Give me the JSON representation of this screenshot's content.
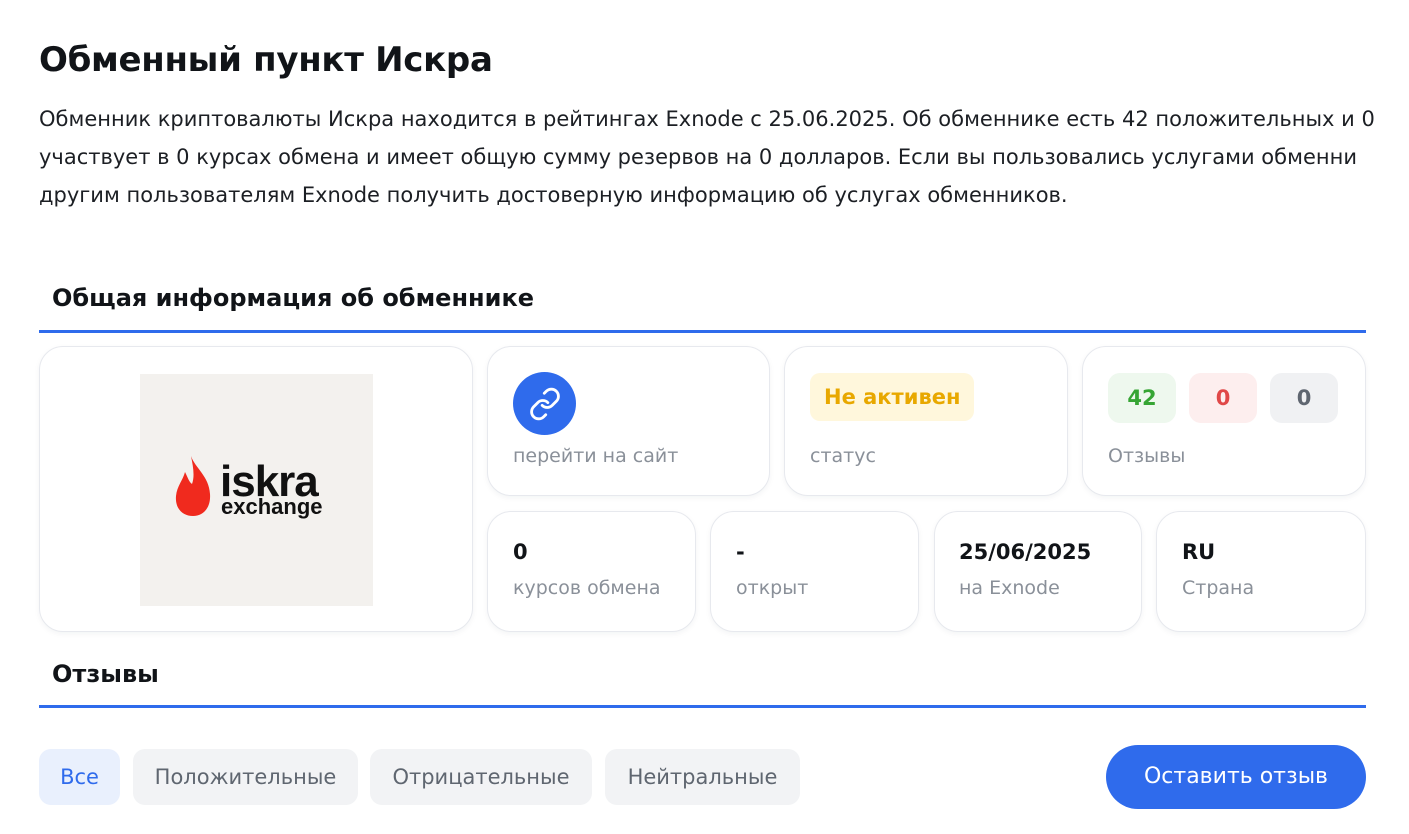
{
  "page": {
    "title": "Обменный пункт Искра",
    "intro_lines": [
      "Обменник криптовалюты Искра находится в рейтингах Exnode с 25.06.2025. Об обменнике есть 42 положительных и 0",
      "участвует в 0 курсах обмена и имеет общую сумму резервов на 0 долларов. Если вы пользовались услугами обменни",
      "другим пользователям Exnode получить достоверную информацию об услугах обменников."
    ]
  },
  "general": {
    "section_title": "Общая информация об обменнике",
    "logo": {
      "word": "iskra",
      "sub": "exchange",
      "icon": "flame-icon",
      "flame_color": "#f02a1e"
    },
    "site": {
      "label": "перейти на сайт",
      "icon": "link-icon"
    },
    "status": {
      "value": "Не активен",
      "label": "статус"
    },
    "reviews": {
      "positive": "42",
      "negative": "0",
      "neutral": "0",
      "label": "Отзывы"
    },
    "stats": [
      {
        "value": "0",
        "label": "курсов обмена"
      },
      {
        "value": "-",
        "label": "открыт"
      },
      {
        "value": "25/06/2025",
        "label": "на Exnode"
      },
      {
        "value": "RU",
        "label": "Страна"
      }
    ]
  },
  "reviews_section": {
    "title": "Отзывы",
    "filters": [
      "Все",
      "Положительные",
      "Отрицательные",
      "Нейтральные"
    ],
    "active_filter_index": 0,
    "cta_label": "Оставить отзыв"
  },
  "colors": {
    "accent": "#2f6bec",
    "status_text": "#e8a800",
    "positive": "#36a534",
    "negative": "#e04848",
    "neutral": "#5f6670"
  }
}
